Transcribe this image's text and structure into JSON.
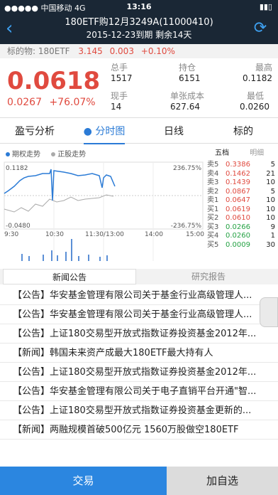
{
  "status": {
    "carrier": "●●●●● 中国移动 4G",
    "time": "13:16",
    "battery": "▮▮▯"
  },
  "nav": {
    "title": "180ETF购12月3249A(11000410)",
    "subtitle": "2015-12-23到期 剩余14天"
  },
  "underlying": {
    "label": "标的物: 180ETF",
    "price": "3.145",
    "change": "0.003",
    "pct": "+0.10%"
  },
  "quote": {
    "price": "0.0618",
    "change": "0.0267",
    "pct": "+76.07%",
    "cells": [
      {
        "k": "总手",
        "v": "1517"
      },
      {
        "k": "持仓",
        "v": "6151"
      },
      {
        "k": "最高",
        "v": "0.1182"
      },
      {
        "k": "现手",
        "v": "14"
      },
      {
        "k": "单张成本",
        "v": "627.64"
      },
      {
        "k": "最低",
        "v": "0.0260"
      }
    ]
  },
  "tabs": [
    "盈亏分析",
    "● 分时图",
    "日线",
    "标的"
  ],
  "chart": {
    "legend": [
      "期权走势",
      "正股走势"
    ],
    "legend_colors": [
      "#2b7bd6",
      "#aaaaaa"
    ],
    "ymax": "0.1182",
    "ymin": "-0.0480",
    "pmax": "236.75%",
    "pmin": "-236.75%",
    "xticks": [
      "9:30",
      "10:30",
      "11:30/13:00",
      "14:00",
      "15:00"
    ]
  },
  "orderbook": {
    "tabs": [
      "五档",
      "明细"
    ],
    "rows": [
      {
        "n": "卖5",
        "p": "0.3386",
        "q": "5",
        "c": "red"
      },
      {
        "n": "卖4",
        "p": "0.1462",
        "q": "21",
        "c": "red"
      },
      {
        "n": "卖3",
        "p": "0.1439",
        "q": "10",
        "c": "red"
      },
      {
        "n": "卖2",
        "p": "0.0867",
        "q": "5",
        "c": "red"
      },
      {
        "n": "卖1",
        "p": "0.0647",
        "q": "10",
        "c": "red"
      },
      {
        "n": "买1",
        "p": "0.0619",
        "q": "10",
        "c": "red"
      },
      {
        "n": "买2",
        "p": "0.0610",
        "q": "10",
        "c": "red"
      },
      {
        "n": "买3",
        "p": "0.0266",
        "q": "9",
        "c": "green"
      },
      {
        "n": "买4",
        "p": "0.0260",
        "q": "1",
        "c": "green"
      },
      {
        "n": "买5",
        "p": "0.0009",
        "q": "30",
        "c": "green"
      }
    ]
  },
  "newstabs": [
    "新闻公告",
    "研究报告"
  ],
  "news": [
    "【公告】华安基金管理有限公司关于基金行业高级管理人...",
    "【公告】华安基金管理有限公司关于基金行业高级管理人...",
    "【公告】上证180交易型开放式指数证券投资基金2012年...",
    "【新闻】韩国未来资产成最大180ETF最大持有人",
    "【公告】上证180交易型开放式指数证券投资基金2012年...",
    "【公告】华安基金管理有限公司关于电子直销平台开通\"智...",
    "【公告】上证180交易型开放式指数证券投资基金更新的...",
    "【新闻】两融规模首破500亿元 1560万股做空180ETF"
  ],
  "bottom": {
    "trade": "交易",
    "add": "加自选"
  }
}
